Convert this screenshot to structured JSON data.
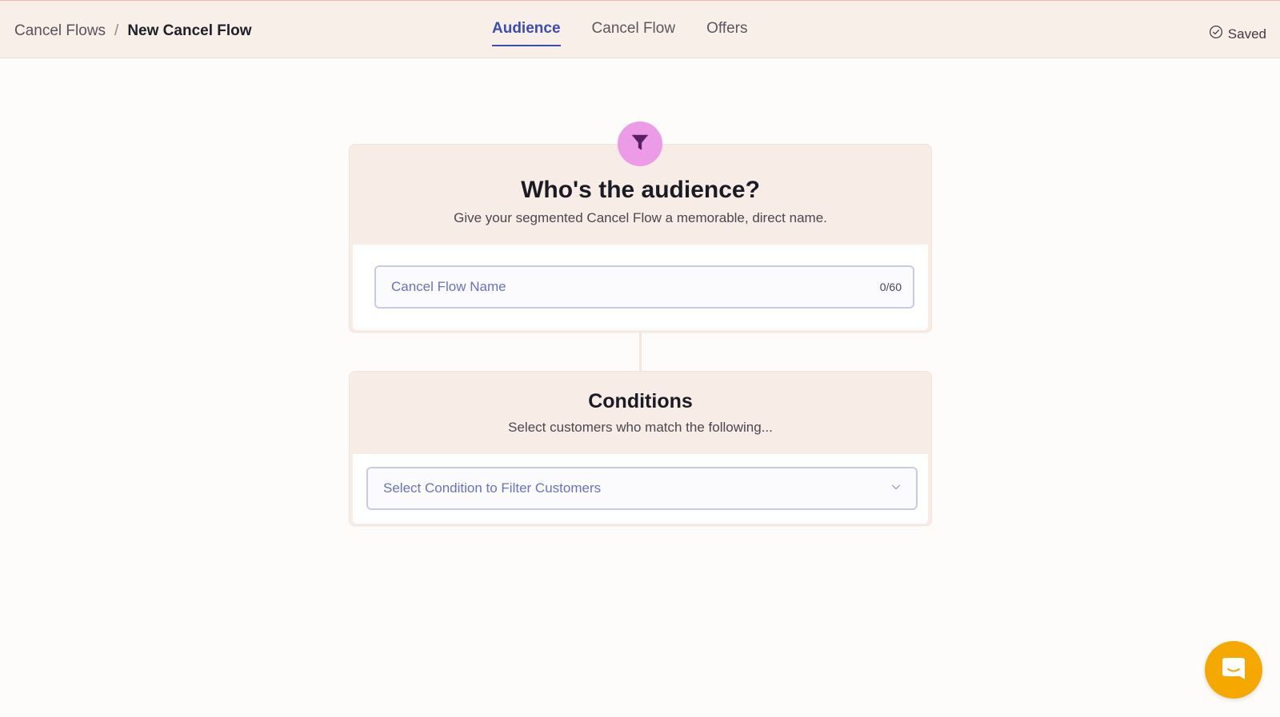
{
  "breadcrumb": {
    "parent": "Cancel Flows",
    "separator": "/",
    "current": "New Cancel Flow"
  },
  "tabs": [
    {
      "label": "Audience",
      "active": true
    },
    {
      "label": "Cancel Flow",
      "active": false
    },
    {
      "label": "Offers",
      "active": false
    }
  ],
  "status": {
    "label": "Saved",
    "icon": "check-circle-icon"
  },
  "audience_card": {
    "icon": "funnel-icon",
    "title": "Who's the audience?",
    "subtitle": "Give your segmented Cancel Flow a memorable, direct name.",
    "name_field": {
      "value": "",
      "placeholder": "Cancel Flow Name",
      "char_count": "0/60"
    }
  },
  "conditions_card": {
    "title": "Conditions",
    "subtitle": "Select customers who match the following...",
    "condition_select": {
      "placeholder": "Select Condition to Filter Customers",
      "icon": "chevron-down-icon"
    }
  },
  "chat_widget": {
    "icon": "chat-icon"
  },
  "colors": {
    "accent": "#3b4db3",
    "header_bg": "#f8efe9",
    "card_bg": "#f7ede6",
    "funnel_badge": "#ec9ce6",
    "chat_button": "#f5a800",
    "field_border": "#c7cbe9",
    "placeholder_text": "#6873bf"
  }
}
